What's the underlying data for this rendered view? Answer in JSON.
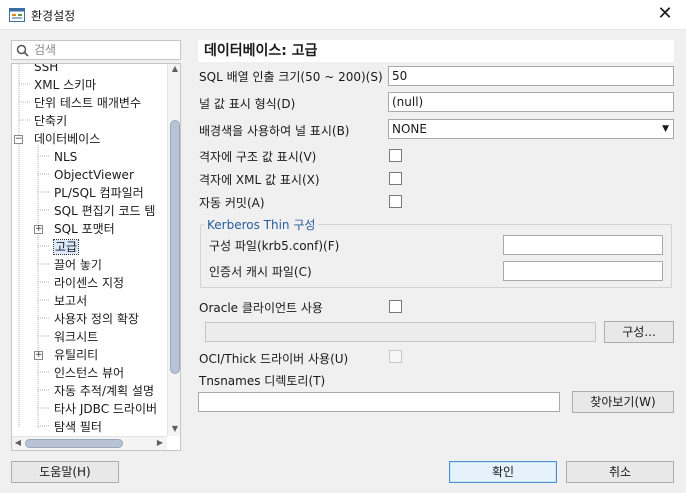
{
  "window": {
    "title": "환경설정",
    "close_glyph": "✕"
  },
  "search": {
    "placeholder": "검색"
  },
  "tree": {
    "items": [
      {
        "label": "SSH",
        "level": 1
      },
      {
        "label": "XML 스키마",
        "level": 1
      },
      {
        "label": "단위 테스트 매개변수",
        "level": 1
      },
      {
        "label": "단축키",
        "level": 1
      },
      {
        "label": "데이터베이스",
        "level": 1,
        "expander": "−"
      },
      {
        "label": "NLS",
        "level": 2
      },
      {
        "label": "ObjectViewer",
        "level": 2
      },
      {
        "label": "PL/SQL 컴파일러",
        "level": 2
      },
      {
        "label": "SQL 편집기 코드 템",
        "level": 2
      },
      {
        "label": "SQL 포맷터",
        "level": 2,
        "expander": "+"
      },
      {
        "label": "고급",
        "level": 2,
        "selected": true
      },
      {
        "label": "끌어 놓기",
        "level": 2
      },
      {
        "label": "라이센스 지정",
        "level": 2
      },
      {
        "label": "보고서",
        "level": 2
      },
      {
        "label": "사용자 정의 확장",
        "level": 2
      },
      {
        "label": "워크시트",
        "level": 2
      },
      {
        "label": "유틸리티",
        "level": 2,
        "expander": "+"
      },
      {
        "label": "인스턴스 뷰어",
        "level": 2
      },
      {
        "label": "자동 추적/계획 설명",
        "level": 2
      },
      {
        "label": "타사 JDBC 드라이버",
        "level": 2
      },
      {
        "label": "탐색 필터",
        "level": 2
      }
    ]
  },
  "panel": {
    "title": "데이터베이스: 고급",
    "fields": {
      "fetch_size_label": "SQL 배열 인출 크기(50 ~ 200)(S)",
      "fetch_size_value": "50",
      "null_display_label": "널 값 표시 형식(D)",
      "null_display_value": "(null)",
      "bg_null_label": "배경색을 사용하여 널 표시(B)",
      "bg_null_value": "NONE",
      "grid_struct_label": "격자에 구조 값 표시(V)",
      "grid_xml_label": "격자에 XML 값 표시(X)",
      "autocommit_label": "자동 커밋(A)"
    },
    "kerberos": {
      "title": "Kerberos Thin 구성",
      "config_label": "구성 파일(krb5.conf)(F)",
      "config_value": "",
      "cache_label": "인증서 캐시 파일(C)",
      "cache_value": ""
    },
    "oracle_client_label": "Oracle 클라이언트 사용",
    "oracle_client_path": "",
    "configure_button": "구성...",
    "oci_thick_label": "OCI/Thick 드라이버 사용(U)",
    "tnsnames_label": "Tnsnames 디렉토리(T)",
    "tnsnames_value": "",
    "browse_button": "찾아보기(W)"
  },
  "footer": {
    "help_button": "도움말(H)",
    "ok_button": "확인",
    "cancel_button": "취소"
  },
  "colors": {
    "accent": "#2a5c9a",
    "selection": "#dce9fb",
    "default_button_border": "#4a90d9"
  }
}
